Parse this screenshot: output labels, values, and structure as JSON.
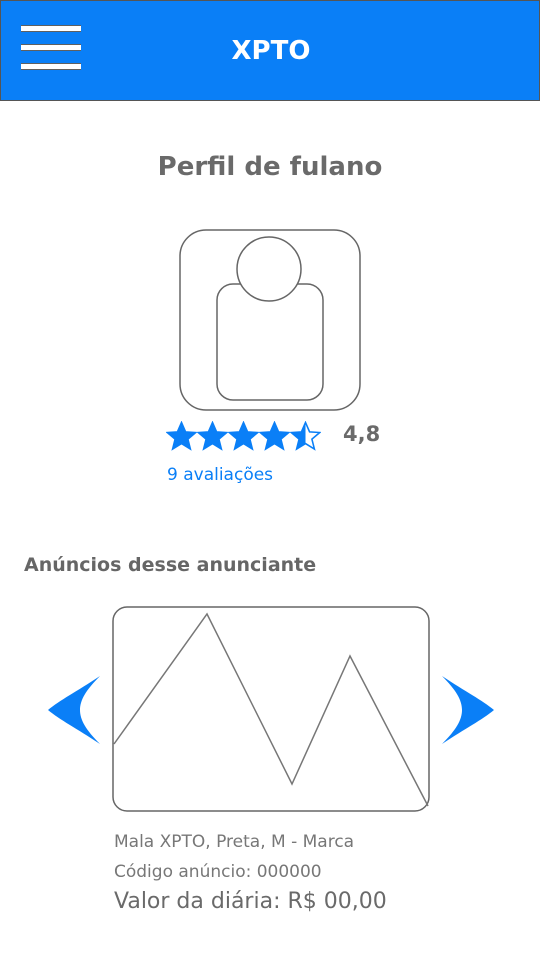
{
  "header": {
    "title": "XPTO",
    "menu_icon": "hamburger-menu-icon"
  },
  "profile": {
    "title": "Perfil de fulano",
    "avatar_icon": "user-avatar-icon",
    "rating": 4.5,
    "rating_max": 5,
    "rating_label": "4,8",
    "reviews_label": "9 avaliações"
  },
  "listings": {
    "section_title": "Anúncios desse anunciante",
    "prev_icon": "chevron-left-icon",
    "next_icon": "chevron-right-icon",
    "image_icon": "image-placeholder-icon",
    "item": {
      "name": "Mala XPTO, Preta, M - Marca",
      "code": "Código anúncio: 000000",
      "price": "Valor da diária: R$ 00,00"
    }
  },
  "colors": {
    "primary": "#0a7ff7",
    "text_gray": "#6a6a6a"
  }
}
